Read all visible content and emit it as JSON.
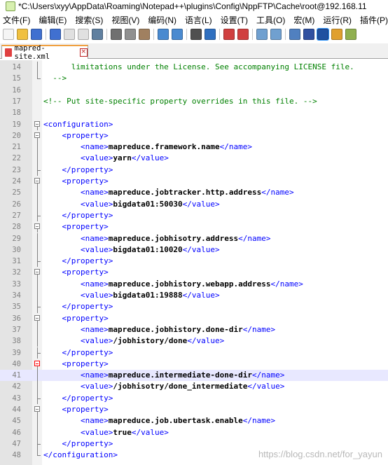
{
  "window": {
    "title": "*C:\\Users\\xyy\\AppData\\Roaming\\Notepad++\\plugins\\Config\\NppFTP\\Cache\\root@192.168.11"
  },
  "menu": [
    "文件(F)",
    "编辑(E)",
    "搜索(S)",
    "视图(V)",
    "编码(N)",
    "语言(L)",
    "设置(T)",
    "工具(O)",
    "宏(M)",
    "运行(R)",
    "插件(P)"
  ],
  "toolbar_icons": [
    "new-file-icon",
    "open-file-icon",
    "save-icon",
    "save-all-icon",
    "close-icon",
    "close-all-icon",
    "print-icon",
    "cut-icon",
    "copy-icon",
    "paste-icon",
    "undo-icon",
    "redo-icon",
    "find-icon",
    "replace-icon",
    "zoom-in-icon",
    "zoom-out-icon",
    "sync-vertical-icon",
    "sync-horizontal-icon",
    "word-wrap-icon",
    "show-all-chars-icon",
    "indent-guide-icon",
    "user-lang-icon",
    "doc-map-icon"
  ],
  "tab": {
    "label": "mapred-site.xml",
    "close": "×"
  },
  "editor": {
    "highlight_line": 41,
    "lines": [
      {
        "n": "14",
        "parts": [
          {
            "t": "      limitations under the License. See accompanying LICENSE file.",
            "c": "comment"
          }
        ]
      },
      {
        "n": "15",
        "parts": [
          {
            "t": "  -->",
            "c": "comment"
          }
        ]
      },
      {
        "n": "16",
        "parts": []
      },
      {
        "n": "17",
        "parts": [
          {
            "t": "<!-- Put site-specific property overrides in this file. -->",
            "c": "comment"
          }
        ]
      },
      {
        "n": "18",
        "parts": []
      },
      {
        "n": "19",
        "parts": [
          {
            "t": "<configuration>",
            "c": "tag"
          }
        ]
      },
      {
        "n": "20",
        "parts": [
          {
            "t": "    <property>",
            "c": "tag"
          }
        ]
      },
      {
        "n": "21",
        "parts": [
          {
            "t": "        <name>",
            "c": "tag"
          },
          {
            "t": "mapreduce.framework.name",
            "c": "text"
          },
          {
            "t": "</name>",
            "c": "tag"
          }
        ]
      },
      {
        "n": "22",
        "parts": [
          {
            "t": "        <value>",
            "c": "tag"
          },
          {
            "t": "yarn",
            "c": "text"
          },
          {
            "t": "</value>",
            "c": "tag"
          }
        ]
      },
      {
        "n": "23",
        "parts": [
          {
            "t": "    </property>",
            "c": "tag"
          }
        ]
      },
      {
        "n": "24",
        "parts": [
          {
            "t": "    <property>",
            "c": "tag"
          }
        ]
      },
      {
        "n": "25",
        "parts": [
          {
            "t": "        <name>",
            "c": "tag"
          },
          {
            "t": "mapreduce.jobtracker.http.address",
            "c": "text"
          },
          {
            "t": "</name>",
            "c": "tag"
          }
        ]
      },
      {
        "n": "26",
        "parts": [
          {
            "t": "        <value>",
            "c": "tag"
          },
          {
            "t": "bigdata01:50030",
            "c": "text"
          },
          {
            "t": "</value>",
            "c": "tag"
          }
        ]
      },
      {
        "n": "27",
        "parts": [
          {
            "t": "    </property>",
            "c": "tag"
          }
        ]
      },
      {
        "n": "28",
        "parts": [
          {
            "t": "    <property>",
            "c": "tag"
          }
        ]
      },
      {
        "n": "29",
        "parts": [
          {
            "t": "        <name>",
            "c": "tag"
          },
          {
            "t": "mapreduce.jobhisotry.address",
            "c": "text"
          },
          {
            "t": "</name>",
            "c": "tag"
          }
        ]
      },
      {
        "n": "30",
        "parts": [
          {
            "t": "        <value>",
            "c": "tag"
          },
          {
            "t": "bigdata01:10020",
            "c": "text"
          },
          {
            "t": "</value>",
            "c": "tag"
          }
        ]
      },
      {
        "n": "31",
        "parts": [
          {
            "t": "    </property>",
            "c": "tag"
          }
        ]
      },
      {
        "n": "32",
        "parts": [
          {
            "t": "    <property>",
            "c": "tag"
          }
        ]
      },
      {
        "n": "33",
        "parts": [
          {
            "t": "        <name>",
            "c": "tag"
          },
          {
            "t": "mapreduce.jobhistory.webapp.address",
            "c": "text"
          },
          {
            "t": "</name>",
            "c": "tag"
          }
        ]
      },
      {
        "n": "34",
        "parts": [
          {
            "t": "        <value>",
            "c": "tag"
          },
          {
            "t": "bigdata01:19888",
            "c": "text"
          },
          {
            "t": "</value>",
            "c": "tag"
          }
        ]
      },
      {
        "n": "35",
        "parts": [
          {
            "t": "    </property>",
            "c": "tag"
          }
        ]
      },
      {
        "n": "36",
        "parts": [
          {
            "t": "    <property>",
            "c": "tag"
          }
        ]
      },
      {
        "n": "37",
        "parts": [
          {
            "t": "        <name>",
            "c": "tag"
          },
          {
            "t": "mapreduce.jobhistory.done-dir",
            "c": "text"
          },
          {
            "t": "</name>",
            "c": "tag"
          }
        ]
      },
      {
        "n": "38",
        "parts": [
          {
            "t": "        <value>",
            "c": "tag"
          },
          {
            "t": "/jobhistory/done",
            "c": "text"
          },
          {
            "t": "</value>",
            "c": "tag"
          }
        ]
      },
      {
        "n": "39",
        "parts": [
          {
            "t": "    </property>",
            "c": "tag"
          }
        ]
      },
      {
        "n": "40",
        "parts": [
          {
            "t": "    <property>",
            "c": "tag"
          }
        ]
      },
      {
        "n": "41",
        "parts": [
          {
            "t": "        <name>",
            "c": "tag"
          },
          {
            "t": "mapreduce.intermediate-done-dir",
            "c": "text"
          },
          {
            "t": "</name>",
            "c": "tag"
          }
        ]
      },
      {
        "n": "42",
        "parts": [
          {
            "t": "        <value>",
            "c": "tag"
          },
          {
            "t": "/jobhisotry/done_intermediate",
            "c": "text"
          },
          {
            "t": "</value>",
            "c": "tag"
          }
        ]
      },
      {
        "n": "43",
        "parts": [
          {
            "t": "    </property>",
            "c": "tag"
          }
        ]
      },
      {
        "n": "44",
        "parts": [
          {
            "t": "    <property>",
            "c": "tag"
          }
        ]
      },
      {
        "n": "45",
        "parts": [
          {
            "t": "        <name>",
            "c": "tag"
          },
          {
            "t": "mapreduce.job.ubertask.enable",
            "c": "text"
          },
          {
            "t": "</name>",
            "c": "tag"
          }
        ]
      },
      {
        "n": "46",
        "parts": [
          {
            "t": "        <value>",
            "c": "tag"
          },
          {
            "t": "true",
            "c": "text"
          },
          {
            "t": "</value>",
            "c": "tag"
          }
        ]
      },
      {
        "n": "47",
        "parts": [
          {
            "t": "    </property>",
            "c": "tag"
          }
        ]
      },
      {
        "n": "48",
        "parts": [
          {
            "t": "</configuration>",
            "c": "tag"
          }
        ]
      }
    ]
  },
  "watermark": "https://blog.csdn.net/for_yayun",
  "colors": {
    "comment": "#008000",
    "tag": "#0000ff",
    "text": "#000000",
    "gutter": "#e4e4e4",
    "highlight": "#e8e8ff"
  }
}
